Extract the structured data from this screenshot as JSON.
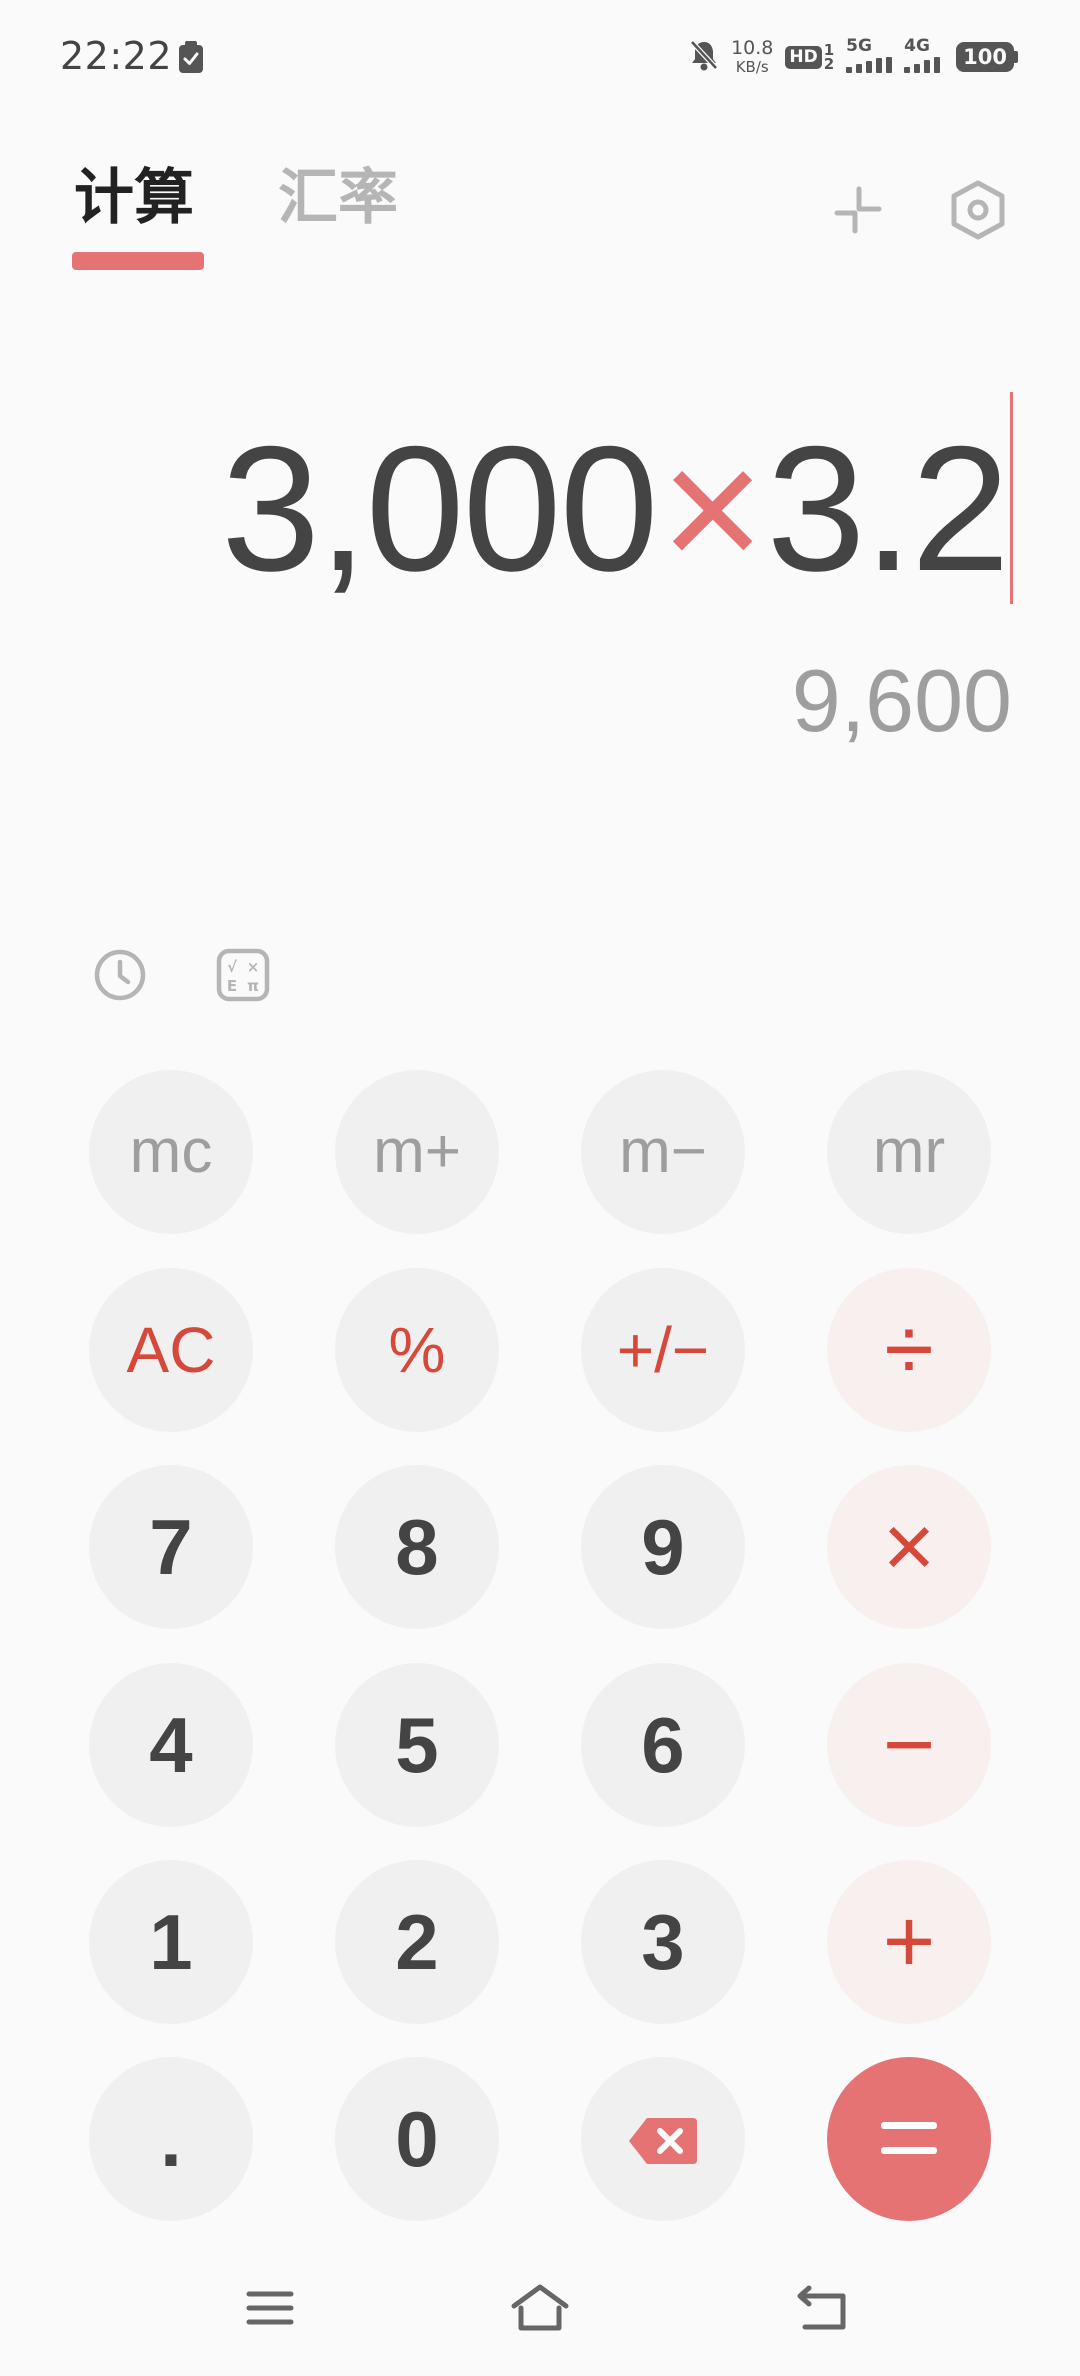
{
  "status_bar": {
    "time": "22:22",
    "net_speed_value": "10.8",
    "net_speed_unit": "KB/s",
    "hd_label": "HD",
    "hd_sim_top": "1",
    "hd_sim_bottom": "2",
    "signal1_label": "5G",
    "signal2_label": "4G",
    "battery": "100",
    "icons": [
      "clipboard-check-icon",
      "mute-bell-icon",
      "signal-icon",
      "battery-icon"
    ]
  },
  "tabs": [
    {
      "label": "计算",
      "active": true
    },
    {
      "label": "汇率",
      "active": false
    }
  ],
  "header_icons": [
    "shrink-icon",
    "settings-icon"
  ],
  "display": {
    "expr_left": "3,000",
    "expr_op": "×",
    "expr_right": "3.2",
    "result": "9,600"
  },
  "tools": [
    "history-icon",
    "scientific-icon"
  ],
  "keys": {
    "mc": "mc",
    "m_plus": "m+",
    "m_minus": "m−",
    "mr": "mr",
    "ac": "AC",
    "percent": "%",
    "plus_minus": "+/−",
    "divide": "÷",
    "d7": "7",
    "d8": "8",
    "d9": "9",
    "multiply": "×",
    "d4": "4",
    "d5": "5",
    "d6": "6",
    "minus": "−",
    "d1": "1",
    "d2": "2",
    "d3": "3",
    "plus": "+",
    "dot": ".",
    "d0": "0",
    "backspace": "backspace-icon",
    "equals": "equals-icon"
  },
  "nav": [
    "menu-icon",
    "home-icon",
    "back-icon"
  ],
  "colors": {
    "accent": "#e57373",
    "operator": "#d6493a",
    "text": "#444444",
    "muted": "#9e9e9e",
    "key_bg": "#f0f0f0",
    "op_key_bg": "#f7f0ef",
    "background": "#fafafa"
  }
}
